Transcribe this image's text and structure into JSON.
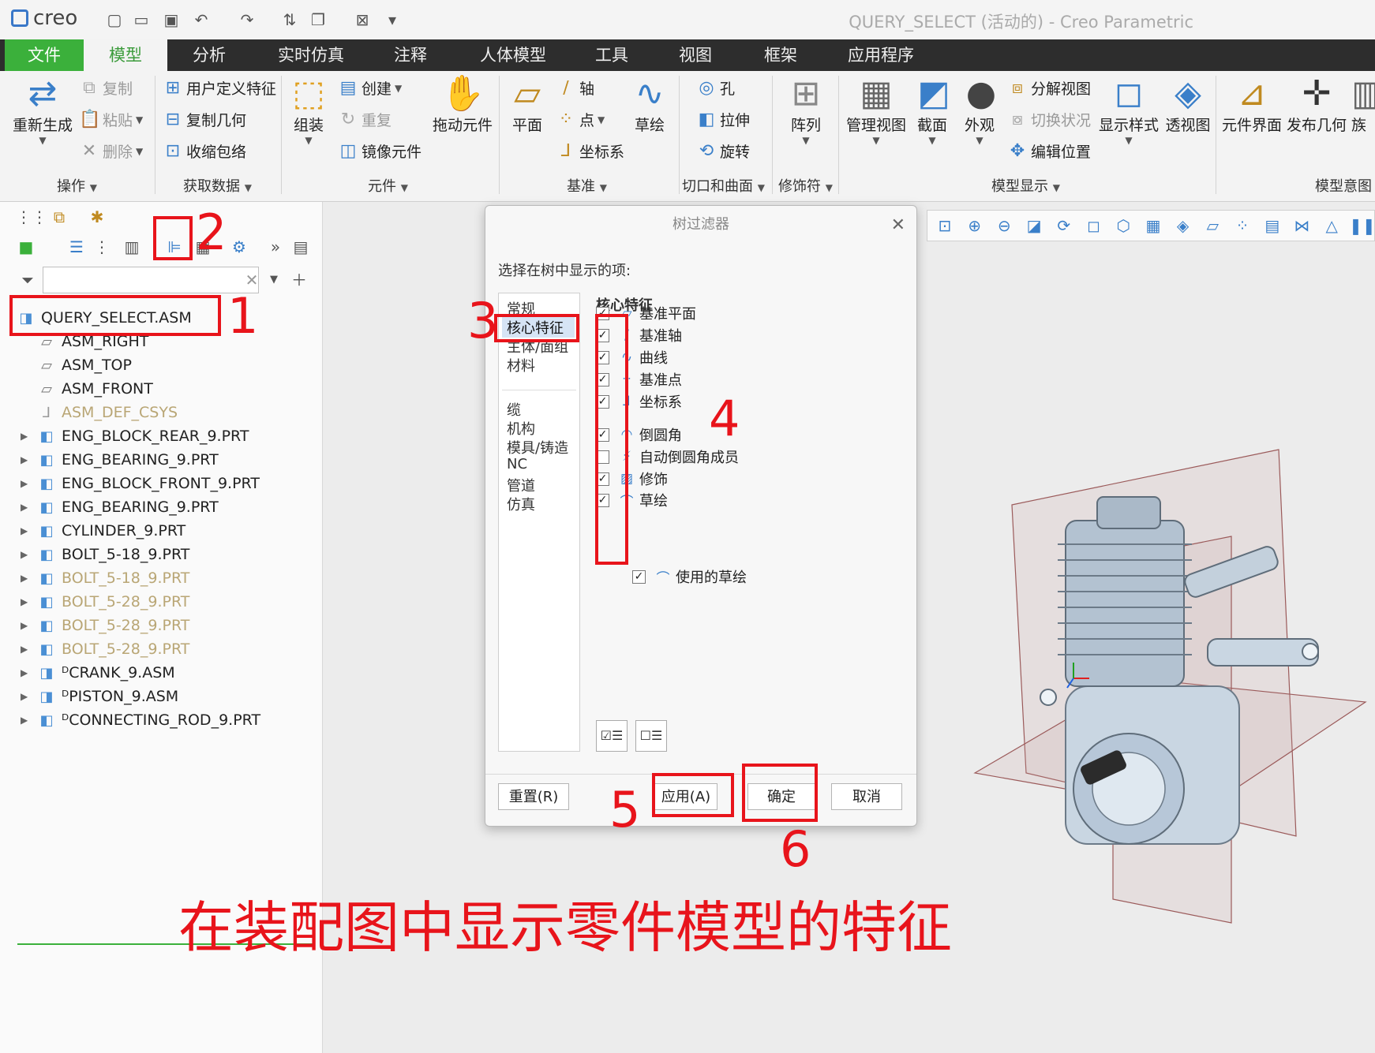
{
  "titlebar": {
    "app_logo": "creo",
    "window_title": "QUERY_SELECT (活动的) - Creo Parametric",
    "quick_access": [
      "new-icon",
      "open-icon",
      "save-icon",
      "undo-icon",
      "redo-icon",
      "regenerate-icon",
      "windows-icon",
      "close-icon",
      "customize-icon"
    ]
  },
  "tabs": [
    "文件",
    "模型",
    "分析",
    "实时仿真",
    "注释",
    "人体模型",
    "工具",
    "视图",
    "框架",
    "应用程序"
  ],
  "ribbon": {
    "regen": "重新生成",
    "copy": "复制",
    "paste": "粘贴",
    "delete": "删除",
    "udf": "用户定义特征",
    "copy_geom": "复制几何",
    "shrinkwrap": "收缩包络",
    "assemble": "组装",
    "create": "创建",
    "repeat": "重复",
    "mirror_comp": "镜像元件",
    "drag_comp": "拖动元件",
    "plane": "平面",
    "axis": "轴",
    "point": "点",
    "csys": "坐标系",
    "sketch": "草绘",
    "hole": "孔",
    "extrude": "拉伸",
    "revolve": "旋转",
    "pattern": "阵列",
    "manage_views": "管理视图",
    "section": "截面",
    "appearance": "外观",
    "explode_view": "分解视图",
    "toggle_status": "切换状况",
    "edit_position": "编辑位置",
    "display_style": "显示样式",
    "perspective": "透视图",
    "comp_interface": "元件界面",
    "publish_geom": "发布几何",
    "family": "族",
    "groups": {
      "operations": "操作",
      "get_data": "获取数据",
      "component": "元件",
      "datum": "基准",
      "cut_surface": "切口和曲面",
      "modifier": "修饰符",
      "model_display": "模型显示",
      "model_intent": "模型意图"
    }
  },
  "tree": {
    "root": "QUERY_SELECT.ASM",
    "items": [
      {
        "label": "ASM_RIGHT",
        "type": "plane",
        "expand": false,
        "dim": false
      },
      {
        "label": "ASM_TOP",
        "type": "plane",
        "expand": false,
        "dim": false
      },
      {
        "label": "ASM_FRONT",
        "type": "plane",
        "expand": false,
        "dim": false
      },
      {
        "label": "ASM_DEF_CSYS",
        "type": "csys",
        "expand": false,
        "dim": true
      },
      {
        "label": "ENG_BLOCK_REAR_9.PRT",
        "type": "part",
        "expand": true,
        "dim": false
      },
      {
        "label": "ENG_BEARING_9.PRT",
        "type": "part",
        "expand": true,
        "dim": false
      },
      {
        "label": "ENG_BLOCK_FRONT_9.PRT",
        "type": "part",
        "expand": true,
        "dim": false
      },
      {
        "label": "ENG_BEARING_9.PRT",
        "type": "part",
        "expand": true,
        "dim": false
      },
      {
        "label": "CYLINDER_9.PRT",
        "type": "part",
        "expand": true,
        "dim": false
      },
      {
        "label": "BOLT_5-18_9.PRT",
        "type": "part",
        "expand": true,
        "dim": false
      },
      {
        "label": "BOLT_5-18_9.PRT",
        "type": "part",
        "expand": true,
        "dim": true
      },
      {
        "label": "BOLT_5-28_9.PRT",
        "type": "part",
        "expand": true,
        "dim": true
      },
      {
        "label": "BOLT_5-28_9.PRT",
        "type": "part",
        "expand": true,
        "dim": true
      },
      {
        "label": "BOLT_5-28_9.PRT",
        "type": "part",
        "expand": true,
        "dim": true
      },
      {
        "label": "ᴰCRANK_9.ASM",
        "type": "asm",
        "expand": true,
        "dim": false
      },
      {
        "label": "ᴰPISTON_9.ASM",
        "type": "asm",
        "expand": true,
        "dim": false
      },
      {
        "label": "ᴰCONNECTING_ROD_9.PRT",
        "type": "part",
        "expand": true,
        "dim": false
      }
    ]
  },
  "dialog": {
    "title": "树过滤器",
    "prompt": "选择在树中显示的项:",
    "categories_top": [
      "常规",
      "核心特征",
      "主体/面组",
      "材料"
    ],
    "categories_bottom": [
      "缆",
      "机构",
      "模具/铸造",
      "NC",
      "管道",
      "仿真"
    ],
    "selected_category": "核心特征",
    "header": "核心特征",
    "features": [
      {
        "label": "基准平面",
        "checked": true,
        "icon": "datum-plane-icon",
        "glyph": "▱"
      },
      {
        "label": "基准轴",
        "checked": true,
        "icon": "datum-axis-icon",
        "glyph": "∕"
      },
      {
        "label": "曲线",
        "checked": true,
        "icon": "curve-icon",
        "glyph": "∿"
      },
      {
        "label": "基准点",
        "checked": true,
        "icon": "datum-point-icon",
        "glyph": "⁘"
      },
      {
        "label": "坐标系",
        "checked": true,
        "icon": "csys-icon",
        "glyph": "⅃"
      },
      {
        "label": "倒圆角",
        "checked": true,
        "icon": "round-icon",
        "glyph": "◠"
      },
      {
        "label": "自动倒圆角成员",
        "checked": false,
        "icon": "auto-round-icon",
        "glyph": "⚡"
      },
      {
        "label": "修饰",
        "checked": true,
        "icon": "cosmetic-icon",
        "glyph": "▨"
      },
      {
        "label": "草绘",
        "checked": true,
        "icon": "sketch-icon",
        "glyph": "⌒"
      }
    ],
    "used_sketch": {
      "label": "使用的草绘",
      "checked": true
    },
    "buttons": {
      "reset": "重置(R)",
      "apply": "应用(A)",
      "ok": "确定",
      "cancel": "取消"
    }
  },
  "annotations": {
    "n1": "1",
    "n2": "2",
    "n3": "3",
    "n4": "4",
    "n5": "5",
    "n6": "6",
    "caption": "在装配图中显示零件模型的特征",
    "color": "#e8141b"
  },
  "colors": {
    "accent_green": "#3bb03b",
    "tab_dark": "#2d2d2d",
    "icon_blue": "#3a7fc9"
  }
}
